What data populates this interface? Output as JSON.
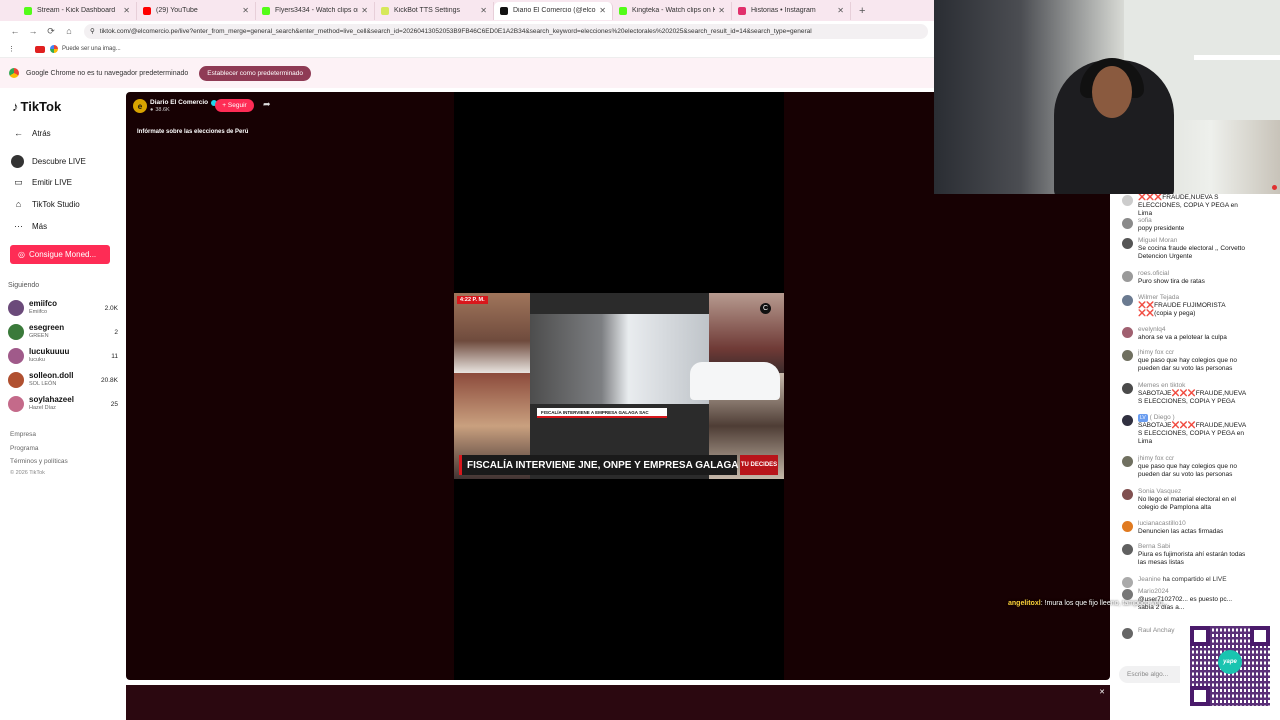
{
  "browser": {
    "tabs": [
      {
        "title": "Stream - Kick Dashboard",
        "color": "#53fc18"
      },
      {
        "title": "(29) YouTube",
        "color": "#ff0000"
      },
      {
        "title": "Flyers3434 - Watch clips on Kick",
        "color": "#53fc18"
      },
      {
        "title": "KickBot TTS Settings",
        "color": "#d6e85a"
      },
      {
        "title": "Diario El Comercio (@elcom",
        "color": "#111111",
        "active": true
      },
      {
        "title": "Kingteka - Watch clips on Kick",
        "color": "#53fc18"
      },
      {
        "title": "Historias • Instagram",
        "color": "#e1306c"
      }
    ],
    "url": "tiktok.com/@elcomercio.pe/live?enter_from_merge=general_search&enter_method=live_cell&search_id=20260413052053B9FB46C6ED0E1A2B34&search_keyword=elecciones%20electorales%202025&search_result_id=14&search_type=general",
    "bookmark": "Puede ser una imag...",
    "infobar_text": "Google Chrome no es tu navegador predeterminado",
    "infobar_button": "Establecer como predeterminado"
  },
  "sidebar": {
    "logo": "TikTok",
    "back": "Atrás",
    "items": [
      {
        "label": "Descubre LIVE",
        "icon": "live-icon"
      },
      {
        "label": "Emitir LIVE",
        "icon": "camera-icon"
      },
      {
        "label": "TikTok Studio",
        "icon": "home-icon"
      },
      {
        "label": "Más",
        "icon": "more-icon"
      }
    ],
    "coins_button": "Consigue Moned...",
    "following_title": "Siguiendo",
    "following": [
      {
        "name": "emiifco",
        "sub": "Emiifco",
        "count": "2.0K",
        "color": "#6b4a7a"
      },
      {
        "name": "esegreen",
        "sub": "GREEN",
        "count": "2",
        "color": "#3a7a3a"
      },
      {
        "name": "lucukuuuu",
        "sub": "lucuku",
        "count": "11",
        "color": "#a05a8a"
      },
      {
        "name": "solleon.doll",
        "sub": "SOL LEÓN",
        "count": "20.8K",
        "color": "#b05030"
      },
      {
        "name": "soylahazeel",
        "sub": "Hazel Díaz",
        "count": "25",
        "color": "#c46a8a"
      }
    ],
    "footer": [
      "Empresa",
      "Programa",
      "Términos y políticas"
    ],
    "copyright": "© 2026 TikTok"
  },
  "live": {
    "host": "Diario El Comercio",
    "viewers": "38.6K",
    "follow": "+ Seguir",
    "notice": "Infórmate sobre las elecciones de Perú",
    "video": {
      "time": "4:22 P. M.",
      "subheadline": "FISCALÍA INTERVIENE A EMPRESA GALAGA SAC",
      "headline": "FISCALÍA INTERVIENE JNE, ONPE Y EMPRESA GALAGA",
      "brand": "TU DECIDES"
    }
  },
  "chat": {
    "messages": [
      {
        "user": "",
        "text": "SABOTAJE ❌❌❌FRAUDE,NUEVA S ELECCIONES, COPIA Y PEGA en Lima",
        "color": "#cccccc"
      },
      {
        "user": "sofia",
        "text": "popy presidente",
        "color": "#8a8a8a"
      },
      {
        "user": "Miguel Moran",
        "text": "Se cocina fraude electoral ,, Corvetto Detencion Urgente",
        "color": "#555555"
      },
      {
        "user": "roes.oficial",
        "text": "Puro show tira de ratas",
        "color": "#9a9a9a"
      },
      {
        "user": "Wilmer Tejada",
        "text": "❌❌FRAUDE FUJIMORISTA ❌❌(copia y pega)",
        "color": "#6a7a90"
      },
      {
        "user": "evelynlq4",
        "text": "ahora se va a pelotear la culpa",
        "color": "#a06070"
      },
      {
        "user": "jhimy fox ccr",
        "text": "que paso que hay colegios que no pueden dar su voto las personas",
        "color": "#707060"
      },
      {
        "user": "Memes en tiktok",
        "text": "SABOTAJE❌❌❌FRAUDE,NUEVA S ELECCIONES, COPIA Y PEGA",
        "color": "#4a4a4a"
      },
      {
        "user": "( Diego )",
        "badge": "LV",
        "text": "SABOTAJE❌❌❌FRAUDE,NUEVA S ELECCIONES, COPIA Y PEGA en Lima",
        "color": "#303040"
      },
      {
        "user": "jhimy fox ccr",
        "text": "que paso que hay colegios que no pueden dar su voto las personas",
        "color": "#707060"
      },
      {
        "user": "Sonia Vasquez",
        "text": "No llego el material electoral en el colegio de Pamplona alta",
        "color": "#805050"
      },
      {
        "user": "lucianacastillo10",
        "text": "Denuncien las actas firmadas",
        "color": "#e07a20"
      },
      {
        "user": "Berna Sabi",
        "text": "Piura es fujimorista ahí estarán todas las mesas listas",
        "color": "#606060"
      },
      {
        "user": "Jeanine",
        "text": "ha compartido el LIVE",
        "color": "#aaaaaa",
        "inline": true
      },
      {
        "user": "Mario2024",
        "text": "@user7102702... es puesto pc... sabía 2 días a...",
        "color": "#777777"
      },
      {
        "user": "Raul Anchay",
        "text": "",
        "color": "#666666"
      }
    ],
    "input_placeholder": "Escribe algo..."
  },
  "overlay": {
    "alert_user": "angelitoxl",
    "alert_text": ": !mura los que fijo lleeno, tampoco voo...",
    "qr_label": "yape"
  }
}
